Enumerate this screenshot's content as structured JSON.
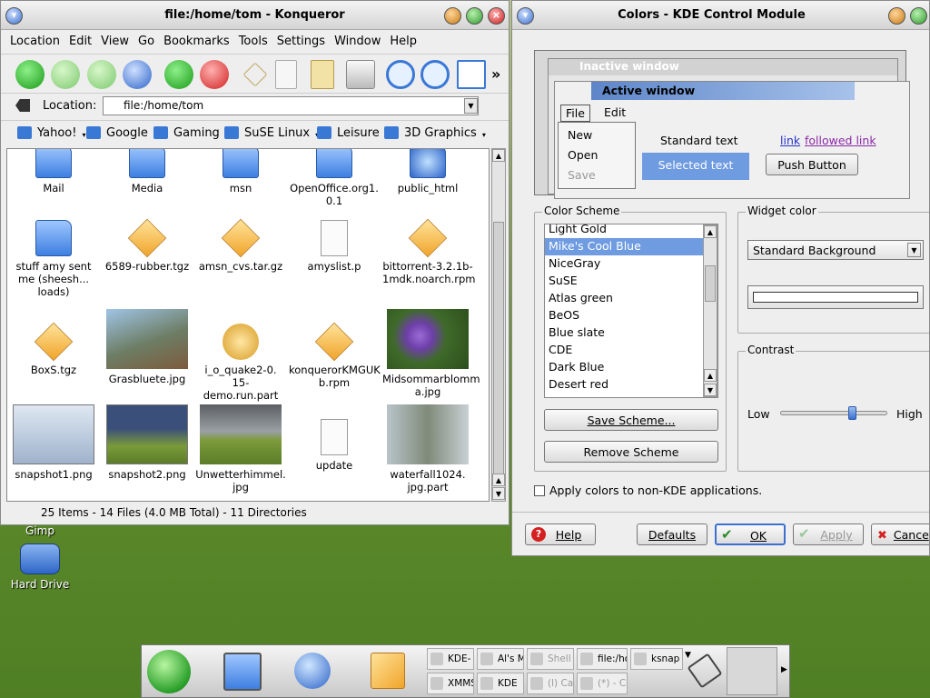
{
  "desktop": {
    "icons": [
      {
        "label": "Gimp"
      },
      {
        "label": "Hard Drive"
      }
    ]
  },
  "konqueror": {
    "title": "file:/home/tom - Konqueror",
    "menu": [
      "Location",
      "Edit",
      "View",
      "Go",
      "Bookmarks",
      "Tools",
      "Settings",
      "Window",
      "Help"
    ],
    "location_label": "Location:",
    "location_value": "file:/home/tom",
    "toolbar_more": "»",
    "bookmarks": [
      "Yahoo!",
      "Google",
      "Gaming",
      "SuSE Linux",
      "Leisure",
      "3D Graphics"
    ],
    "files": [
      {
        "name": "Mail",
        "kind": "folder"
      },
      {
        "name": "Media",
        "kind": "folder"
      },
      {
        "name": "msn",
        "kind": "folder"
      },
      {
        "name": "OpenOffice.org1.\n0.1",
        "kind": "folder"
      },
      {
        "name": "public_html",
        "kind": "folder-web"
      },
      {
        "name": "stuff amy sent\nme (sheesh...\nloads)",
        "kind": "folder"
      },
      {
        "name": "6589-rubber.tgz",
        "kind": "package"
      },
      {
        "name": "amsn_cvs.tar.gz",
        "kind": "package"
      },
      {
        "name": "amyslist.p",
        "kind": "document"
      },
      {
        "name": "bittorrent-3.2.1b-\n1mdk.noarch.rpm",
        "kind": "rpm"
      },
      {
        "name": "BoxS.tgz",
        "kind": "package"
      },
      {
        "name": "Grasbluete.jpg",
        "kind": "image"
      },
      {
        "name": "i_o_quake2-0.\n15-demo.run.part",
        "kind": "partial"
      },
      {
        "name": "konquerorKMGUK\nb.rpm",
        "kind": "rpm"
      },
      {
        "name": "Midsommarblomm\na.jpg",
        "kind": "image"
      },
      {
        "name": "snapshot1.png",
        "kind": "image"
      },
      {
        "name": "snapshot2.png",
        "kind": "image"
      },
      {
        "name": "Unwetterhimmel.\njpg",
        "kind": "image"
      },
      {
        "name": "update",
        "kind": "document"
      },
      {
        "name": "waterfall1024.\njpg.part",
        "kind": "image"
      }
    ],
    "status": "25 Items - 14 Files (4.0 MB Total) - 11 Directories"
  },
  "kcontrol": {
    "title": "Colors - KDE Control Module",
    "preview": {
      "inactive_title": "Inactive window",
      "active_title": "Active window",
      "menu_file": "File",
      "menu_edit": "Edit",
      "menu_items": [
        "New",
        "Open",
        "Save"
      ],
      "standard_text": "Standard text",
      "selected_text": "Selected text",
      "link": "link",
      "followed_link": "followed link",
      "push_button": "Push Button"
    },
    "color_scheme_label": "Color Scheme",
    "schemes": [
      "Light Gold",
      "Mike's Cool Blue",
      "NiceGray",
      "SuSE",
      "Atlas green",
      "BeOS",
      "Blue slate",
      "CDE",
      "Dark Blue",
      "Desert red"
    ],
    "selected_scheme": "Mike's Cool Blue",
    "save_scheme": "Save Scheme...",
    "remove_scheme": "Remove Scheme",
    "widget_color_label": "Widget color",
    "widget_color_value": "Standard Background",
    "contrast_label": "Contrast",
    "contrast_low": "Low",
    "contrast_high": "High",
    "contrast_level": 0.6,
    "apply_non_kde": "Apply colors to non-KDE applications.",
    "buttons": {
      "help": "Help",
      "defaults": "Defaults",
      "ok": "OK",
      "apply": "Apply",
      "cancel": "Cance"
    }
  },
  "panel": {
    "tasks": [
      {
        "label": "KDE-"
      },
      {
        "label": "Al's M"
      },
      {
        "label": "Shell"
      },
      {
        "label": "file:/ho"
      },
      {
        "label": "ksnap"
      },
      {
        "label": "XMMS"
      },
      {
        "label": "KDE"
      },
      {
        "label": "(l) Ca"
      },
      {
        "label": "(*) - C"
      }
    ]
  },
  "colors": {
    "selection": "#6f9be0",
    "accent_blue": "#3b6fd0",
    "close_red": "#c81e1e"
  }
}
